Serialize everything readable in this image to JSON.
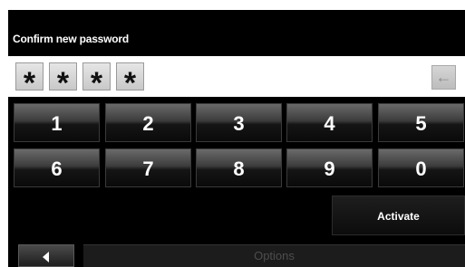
{
  "screen": {
    "title": "Confirm new password"
  },
  "password": {
    "mask_chars": [
      "*",
      "*",
      "*",
      "*"
    ],
    "backspace_icon": "backspace-arrow-icon",
    "backspace_glyph": "←"
  },
  "keypad": {
    "keys": [
      "1",
      "2",
      "3",
      "4",
      "5",
      "6",
      "7",
      "8",
      "9",
      "0"
    ]
  },
  "actions": {
    "activate_label": "Activate",
    "options_label": "Options",
    "back_icon": "back-triangle-icon"
  },
  "colors": {
    "background": "#000000",
    "field": "#ffffff",
    "key_text": "#ffffff",
    "options_text_disabled": "#4d4d4d"
  }
}
